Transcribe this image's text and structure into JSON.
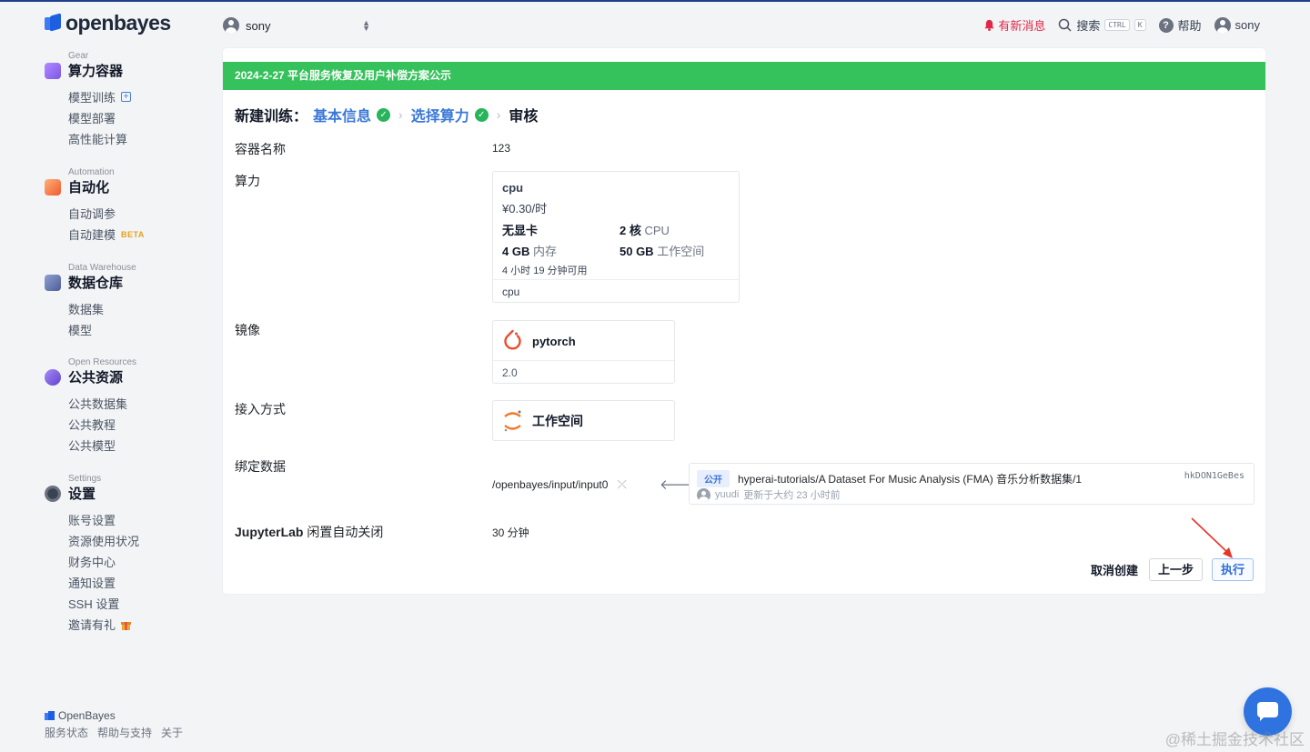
{
  "brand": {
    "name": "openbayes",
    "footer_name": "OpenBayes"
  },
  "sidebar": {
    "groups": [
      {
        "caption": "Gear",
        "title": "算力容器",
        "icon_color": "#8a5cf6",
        "items": [
          {
            "label": "模型训练",
            "extra": "+"
          },
          {
            "label": "模型部署"
          },
          {
            "label": "高性能计算"
          }
        ]
      },
      {
        "caption": "Automation",
        "title": "自动化",
        "icon_color": "#f2673a",
        "items": [
          {
            "label": "自动调参"
          },
          {
            "label": "自动建模",
            "badge": "BETA"
          }
        ]
      },
      {
        "caption": "Data Warehouse",
        "title": "数据仓库",
        "icon_color": "#5a6ea8",
        "items": [
          {
            "label": "数据集"
          },
          {
            "label": "模型"
          }
        ]
      },
      {
        "caption": "Open Resources",
        "title": "公共资源",
        "icon_color": "#7b5ce0",
        "items": [
          {
            "label": "公共数据集"
          },
          {
            "label": "公共教程"
          },
          {
            "label": "公共模型"
          }
        ]
      },
      {
        "caption": "Settings",
        "title": "设置",
        "icon_color": "#3b4252",
        "items": [
          {
            "label": "账号设置"
          },
          {
            "label": "资源使用状况"
          },
          {
            "label": "财务中心"
          },
          {
            "label": "通知设置"
          },
          {
            "label": "SSH 设置"
          },
          {
            "label": "邀请有礼"
          }
        ]
      }
    ],
    "footer_links": [
      "服务状态",
      "帮助与支持",
      "关于"
    ]
  },
  "topbar": {
    "workspace_user": "sony",
    "notifications": "有新消息",
    "search": "搜索",
    "kbd_ctrl": "CTRL",
    "kbd_k": "K",
    "help": "帮助",
    "user": "sony"
  },
  "banner": "2024-2-27 平台服务恢复及用户补偿方案公示",
  "steps": {
    "prefix": "新建训练：",
    "step1": "基本信息",
    "step2": "选择算力",
    "step3": "审核"
  },
  "form": {
    "name_label": "容器名称",
    "name_value": "123",
    "gear_label": "算力",
    "gear": {
      "name": "cpu",
      "price": "¥0.30/时",
      "gpu": "无显卡",
      "cores_value": "2 核",
      "cores_unit": "CPU",
      "mem_value": "4 GB",
      "mem_unit": "内存",
      "disk_value": "50 GB",
      "disk_unit": "工作空间",
      "available": "4 小时 19 分钟可用",
      "footer": "cpu"
    },
    "image_label": "镜像",
    "image": {
      "name": "pytorch",
      "version": "2.0"
    },
    "access_label": "接入方式",
    "access": {
      "name": "工作空间"
    },
    "bind_label": "绑定数据",
    "bind": {
      "path": "/openbayes/input/input0",
      "visibility": "公开",
      "dataset": "hyperai-tutorials/A Dataset For Music Analysis (FMA) 音乐分析数据集/1",
      "hash": "hkDON1GeBes",
      "owner": "yuudi",
      "updated": "更新于大约 23 小时前"
    },
    "idle_label_bold": "JupyterLab",
    "idle_label_rest": " 闲置自动关闭",
    "idle_value": "30 分钟"
  },
  "actions": {
    "cancel": "取消创建",
    "prev": "上一步",
    "run": "执行"
  },
  "watermark": "@稀土掘金技术社区",
  "colors": {
    "banner": "#35c15b",
    "accent": "#3a78d8",
    "alert": "#e0294a",
    "annotation_arrow": "#e8342a"
  }
}
